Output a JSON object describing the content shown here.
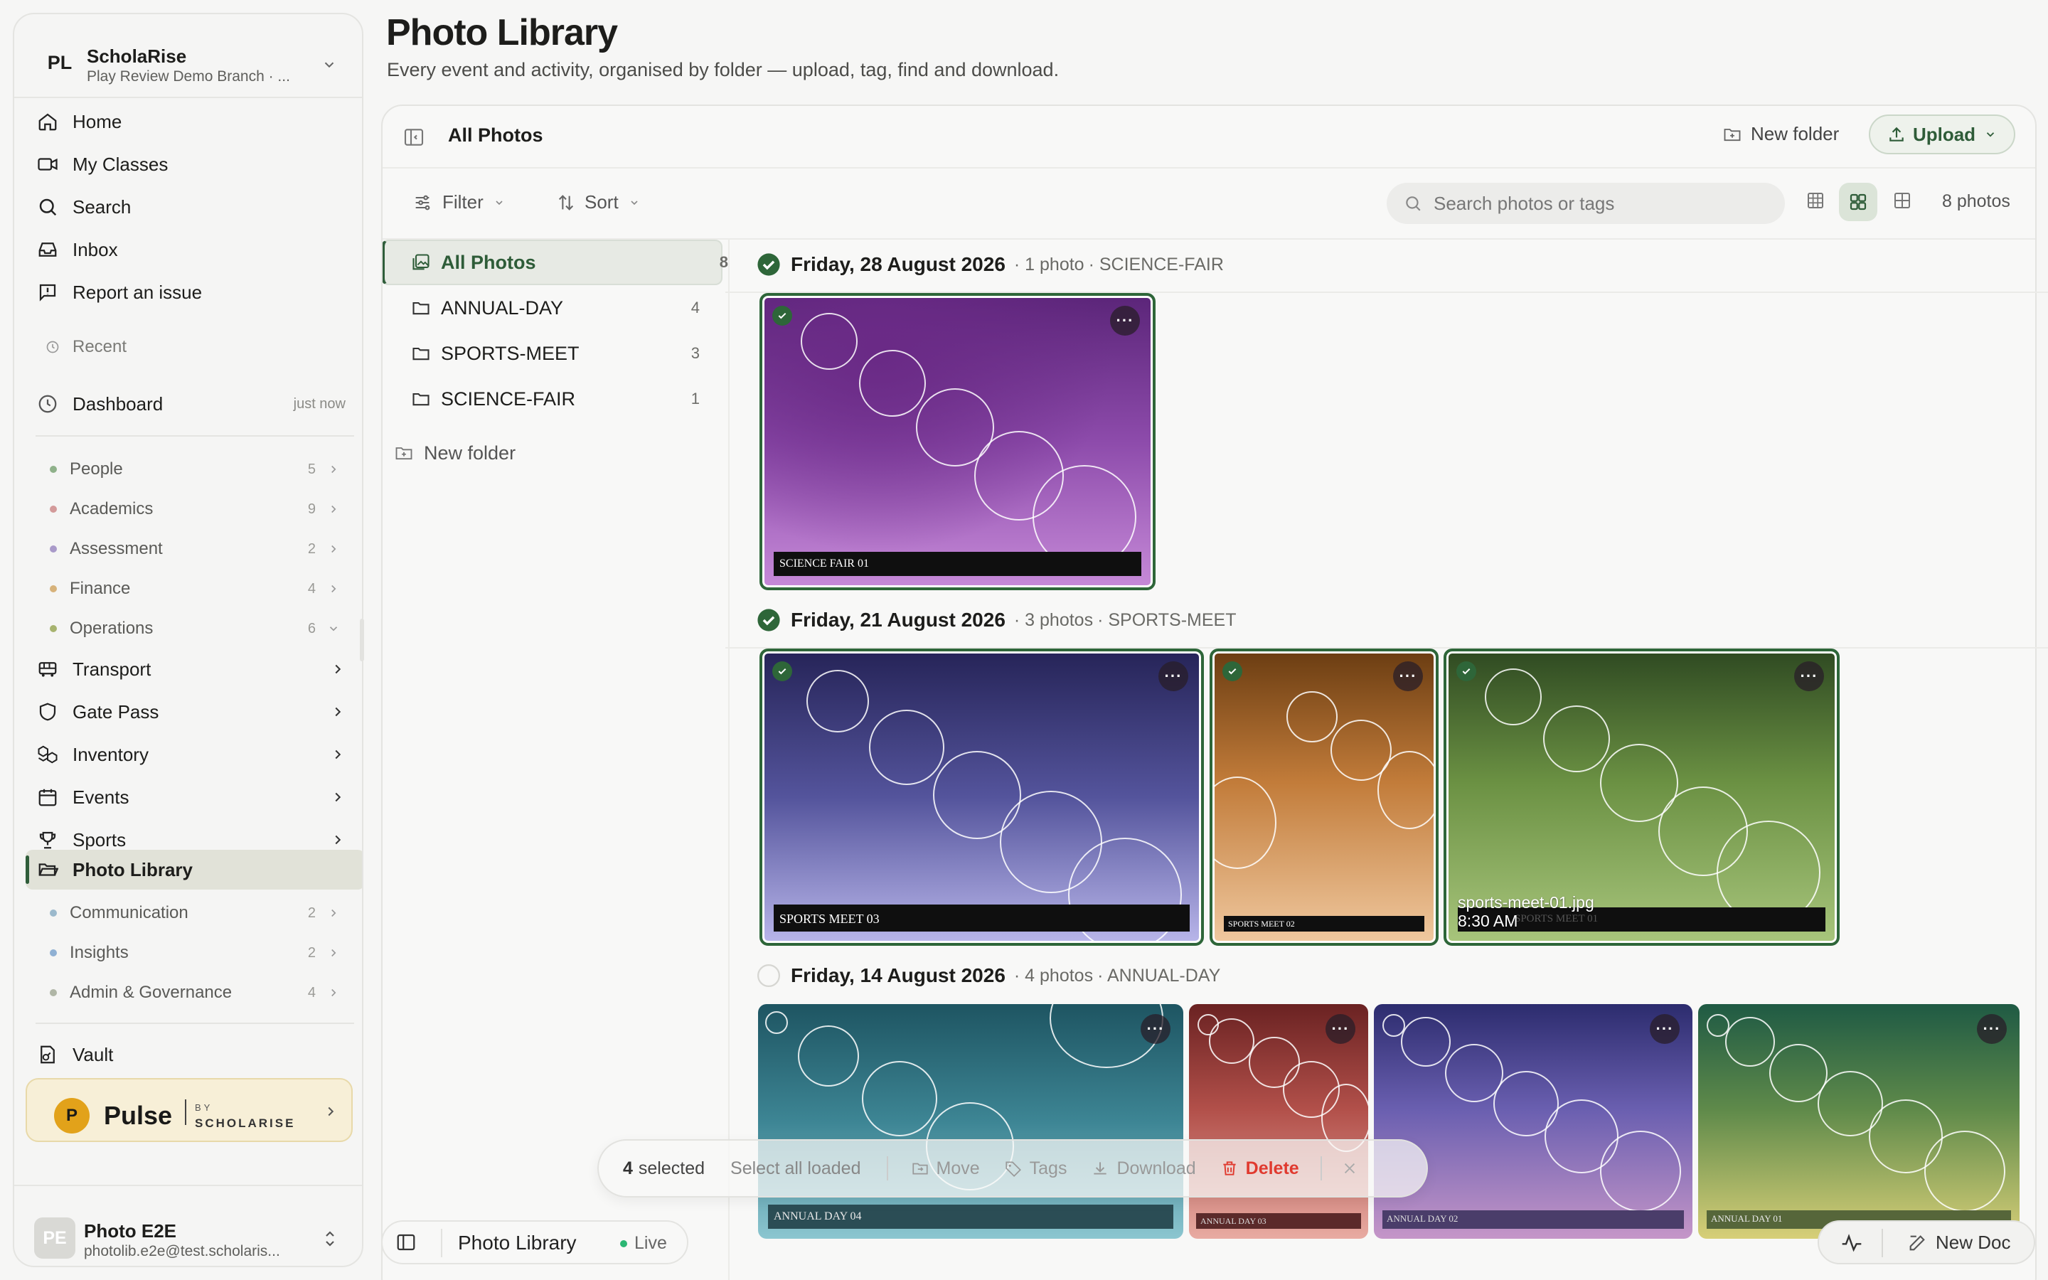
{
  "org": {
    "initials": "PL",
    "name": "ScholaRise",
    "subtitle": "Play Review Demo Branch · ..."
  },
  "nav": {
    "home": "Home",
    "classes": "My Classes",
    "search": "Search",
    "inbox": "Inbox",
    "report": "Report an issue"
  },
  "recent": {
    "label": "Recent",
    "item": "Dashboard",
    "time": "just now"
  },
  "groups": [
    {
      "label": "People",
      "count": "5",
      "color": "#8fb18a"
    },
    {
      "label": "Academics",
      "count": "9",
      "color": "#d39a9a"
    },
    {
      "label": "Assessment",
      "count": "2",
      "color": "#a99ac9"
    },
    {
      "label": "Finance",
      "count": "4",
      "color": "#d7b27a"
    },
    {
      "label": "Operations",
      "count": "6",
      "color": "#a7b36f"
    }
  ],
  "ops_items": {
    "transport": "Transport",
    "gate": "Gate Pass",
    "inventory": "Inventory",
    "events": "Events",
    "sports": "Sports",
    "photo": "Photo Library"
  },
  "groups2": [
    {
      "label": "Communication",
      "count": "2",
      "color": "#9bb9cc"
    },
    {
      "label": "Insights",
      "count": "2",
      "color": "#8fb0d3"
    },
    {
      "label": "Admin & Governance",
      "count": "4",
      "color": "#b0b6a6"
    }
  ],
  "vault": "Vault",
  "pulse": {
    "logo": "P",
    "word": "Pulse",
    "by": "BY",
    "brand": "SCHOLARISE"
  },
  "user": {
    "initials": "PE",
    "name": "Photo E2E",
    "email": "photolib.e2e@test.scholaris..."
  },
  "page": {
    "title": "Photo Library",
    "subtitle": "Every event and activity, organised by folder — upload, tag, find and download."
  },
  "toolbar": {
    "crumb": "All Photos",
    "new_folder": "New folder",
    "upload": "Upload",
    "filter": "Filter",
    "sort": "Sort",
    "search_placeholder": "Search photos or tags",
    "count": "8 photos"
  },
  "folders": [
    {
      "name": "All Photos",
      "count": "8"
    },
    {
      "name": "ANNUAL-DAY",
      "count": "4"
    },
    {
      "name": "SPORTS-MEET",
      "count": "3"
    },
    {
      "name": "SCIENCE-FAIR",
      "count": "1"
    }
  ],
  "tree_new_folder": "New folder",
  "groups_by_date": [
    {
      "date": "Friday, 28 August 2026",
      "meta": "· 1 photo",
      "folder": "· SCIENCE-FAIR",
      "checked": true
    },
    {
      "date": "Friday, 21 August 2026",
      "meta": "· 3 photos",
      "folder": "· SPORTS-MEET",
      "checked": true
    },
    {
      "date": "Friday, 14 August 2026",
      "meta": "· 4 photos",
      "folder": "· ANNUAL-DAY",
      "checked": false
    }
  ],
  "photos": {
    "sf1": "SCIENCE FAIR 01",
    "sm3": "SPORTS MEET 03",
    "sm2": "SPORTS MEET 02",
    "sm1": "SPORTS MEET 01",
    "sm1_name": "sports-meet-01.jpg",
    "sm1_time": "8:30 AM",
    "ad4": "ANNUAL DAY 04",
    "ad3": "ANNUAL DAY 03",
    "ad2": "ANNUAL DAY 02",
    "ad1": "ANNUAL DAY 01"
  },
  "selection": {
    "count": "4",
    "selected": "selected",
    "select_all": "Select all loaded",
    "move": "Move",
    "tags": "Tags",
    "download": "Download",
    "delete": "Delete"
  },
  "footer": {
    "label": "Photo Library",
    "status": "Live",
    "new_doc": "New Doc"
  },
  "colors": {
    "accent": "#2e6639",
    "danger": "#e03a2f",
    "live": "#2bb673"
  }
}
